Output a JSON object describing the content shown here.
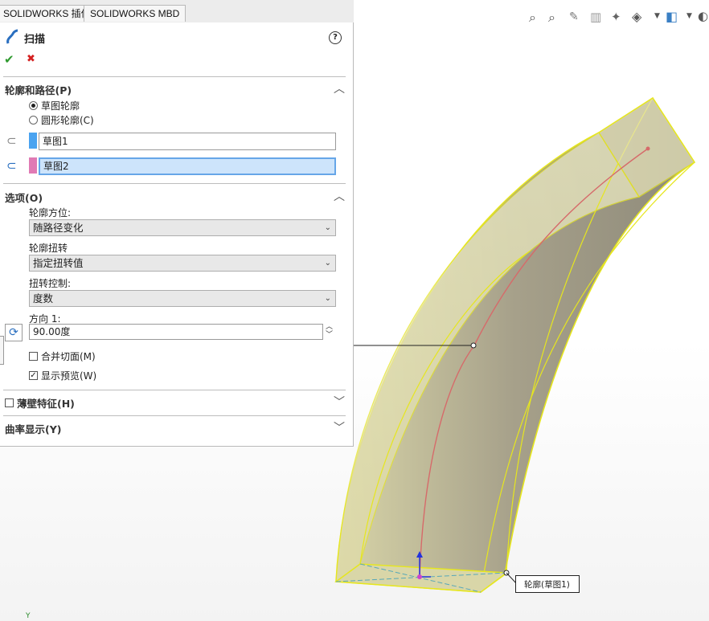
{
  "tabs": [
    "SOLIDWORKS 插件",
    "SOLIDWORKS MBD"
  ],
  "feature": {
    "title": "扫描",
    "help": "?",
    "ok": "✔",
    "cancel": "✖"
  },
  "profile_path": {
    "header": "轮廓和路径(P)",
    "radio_sketch": "草图轮廓",
    "radio_circle": "圆形轮廓(C)",
    "profile_value": "草图1",
    "path_value": "草图2",
    "profile_color": "#4aa3f0",
    "path_color": "#e07ab4"
  },
  "options": {
    "header": "选项(O)",
    "orient_label": "轮廓方位:",
    "orient_value": "随路径变化",
    "twist_label": "轮廓扭转",
    "twist_value": "指定扭转值",
    "twist_ctrl_label": "扭转控制:",
    "twist_ctrl_value": "度数",
    "dir_label": "方向 1:",
    "dir_value": "90.00度",
    "merge_label": "合并切面(M)",
    "preview_label": "显示预览(W)",
    "merge_checked": false,
    "preview_checked": true
  },
  "thin": {
    "header": "薄壁特征(H)"
  },
  "curvature": {
    "header": "曲率显示(Y)"
  },
  "viewport": {
    "callout": "轮廓(草图1)",
    "axis_label": "Y"
  }
}
